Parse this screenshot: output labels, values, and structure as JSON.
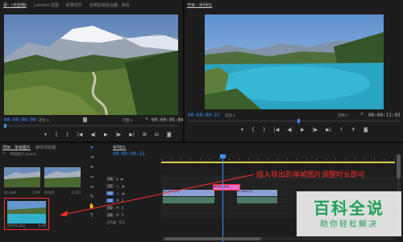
{
  "colors": {
    "accent": "#3d8fff",
    "annotation": "#ff2d2d",
    "watermark": "#22a05c",
    "clip_blue": "#8f9fd6",
    "clip_pink": "#e06fd0"
  },
  "source_monitor": {
    "tabs": [
      "源：(无剪辑)",
      "Lumetri 范围",
      "效果控件",
      "音频剪辑混合器：未标"
    ],
    "active_tab": 0,
    "timecode": "00:00:00:00",
    "zoom": "适合",
    "quality": "完整",
    "duration": "00:00:05:04"
  },
  "program_monitor": {
    "tabs": [
      "节目：序列01"
    ],
    "timecode": "00:00:00:21",
    "zoom": "适合",
    "quality": "完整",
    "duration": "00:00:11:03"
  },
  "project_panel": {
    "tabs": [
      "项目：单帧图片",
      "媒体浏览器"
    ],
    "project_file": "单帧图片.prproj",
    "items": [
      {
        "name": "01.mp4",
        "duration": "5:04"
      },
      {
        "name": "序列01",
        "duration": "11:03"
      },
      {
        "name": "序列01.png",
        "duration": "4:29"
      }
    ]
  },
  "timeline": {
    "tab": "序列01",
    "timecode": "00:00:00:21",
    "tracks": [
      "V3",
      "V2",
      "V1",
      "A1",
      "A2",
      "A3",
      "主声道"
    ],
    "master_value": "0.0",
    "clips": [
      {
        "label": "01.mp4 [V]"
      },
      {
        "label": "01.mp4 [V]"
      },
      {
        "label": "序列01.png"
      }
    ]
  },
  "annotation": {
    "text": "插入导出的单帧图片调整时长即可"
  },
  "watermark": {
    "title": "百科全说",
    "subtitle": "助你轻松解决"
  }
}
